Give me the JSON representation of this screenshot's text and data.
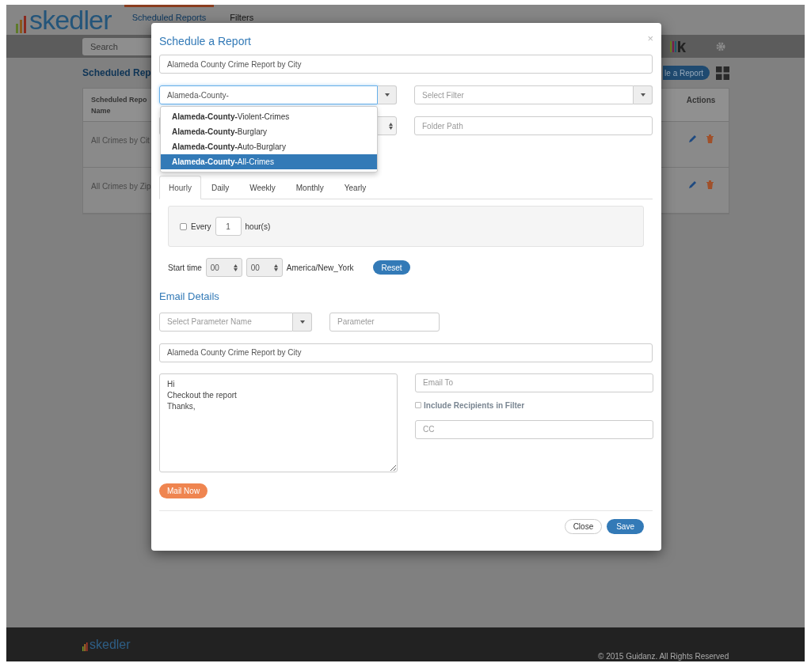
{
  "app": {
    "logo": "skedler",
    "nav_tabs": [
      {
        "label": "Scheduled Reports",
        "selected": true
      },
      {
        "label": "Filters",
        "selected": false
      }
    ],
    "search": {
      "placeholder": "Search"
    }
  },
  "page": {
    "heading": "Scheduled Rep",
    "new_button": "le a Report",
    "table": {
      "columns": [
        {
          "lines": [
            "Scheduled Repo",
            "Name"
          ]
        },
        {
          "lines": [
            "Actions"
          ]
        }
      ],
      "rows": [
        {
          "name": "All Crimes by Cit"
        },
        {
          "name": "All Crimes by Zip"
        }
      ]
    }
  },
  "modal": {
    "title": "Schedule a Report",
    "close": "×",
    "report_name": {
      "value": "Alameda County Crime Report by City"
    },
    "dashboard": {
      "value": "Alameda-County-",
      "expanded": true,
      "options": [
        {
          "label": "**Alameda-County-**Violent-Crimes",
          "selected": false
        },
        {
          "label": "**Alameda-County-**Burglary",
          "selected": false
        },
        {
          "label": "**Alameda-County-**Auto-Burglary",
          "selected": false
        },
        {
          "label": "**Alameda-County-**All-Crimes",
          "selected": true
        }
      ]
    },
    "filter": {
      "placeholder": "Select Filter"
    },
    "folder_path": {
      "placeholder": "Folder Path"
    },
    "schedule_tabs": [
      {
        "label": "Hourly",
        "selected": true
      },
      {
        "label": "Daily",
        "selected": false
      },
      {
        "label": "Weekly",
        "selected": false
      },
      {
        "label": "Monthly",
        "selected": false
      },
      {
        "label": "Yearly",
        "selected": false
      }
    ],
    "hourly": {
      "checked": false,
      "label": "Every",
      "interval": "1",
      "unit": "hour(s)"
    },
    "start_time": {
      "label": "Start time",
      "hour": "00",
      "minute": "00",
      "timezone": "America/New_York",
      "reset": "Reset"
    },
    "email_heading": "Email Details",
    "parameter_name": {
      "placeholder": "Select Parameter Name"
    },
    "parameter": {
      "placeholder": "Parameter"
    },
    "subject": {
      "value": "Alameda County Crime Report by City"
    },
    "body": {
      "value": "Hi\nCheckout the report\nThanks,"
    },
    "email_to": {
      "placeholder": "Email To"
    },
    "include_recipients": {
      "label": "Include Recipients in Filter",
      "checked": false
    },
    "cc": {
      "placeholder": "CC"
    },
    "mail_now": "Mail Now",
    "buttons": [
      {
        "label": "Close",
        "kind": "default"
      },
      {
        "label": "Save",
        "kind": "primary"
      }
    ]
  },
  "footer": {
    "logo": "skedler",
    "copyright": "© 2015 Guidanz. All Rights Reserved"
  }
}
